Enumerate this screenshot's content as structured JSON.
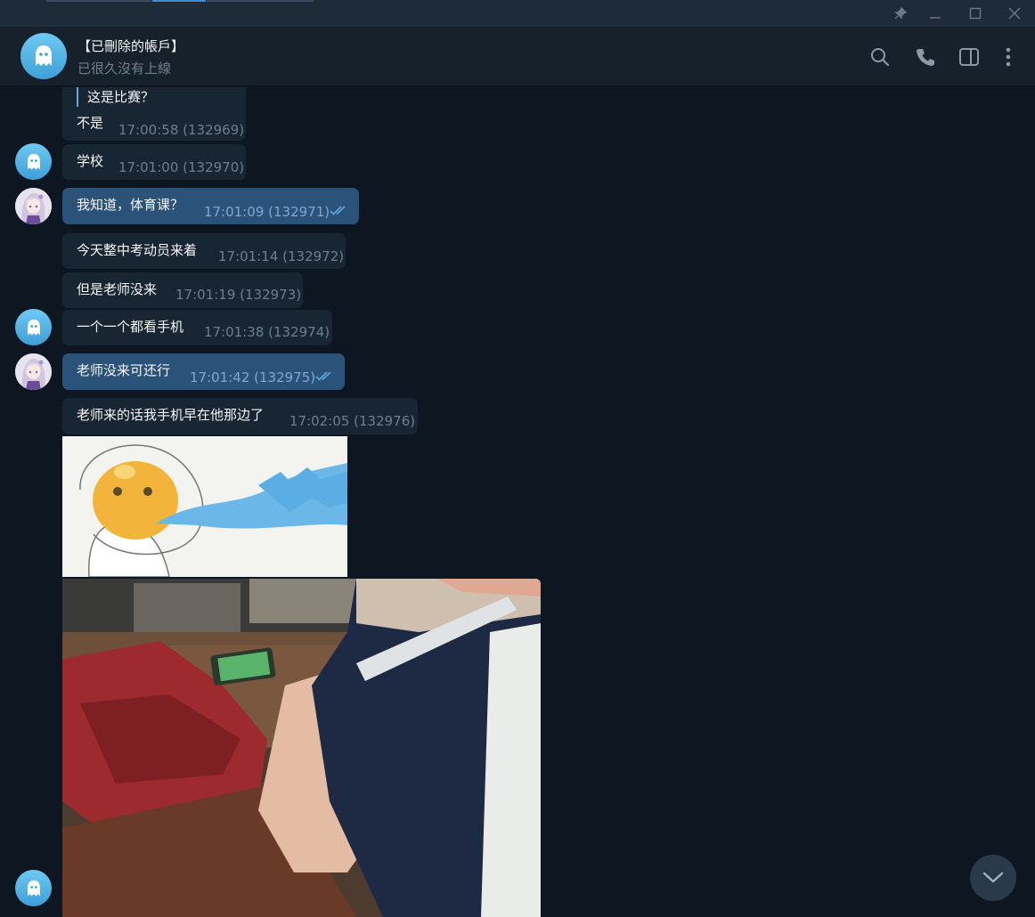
{
  "window": {
    "controls": [
      "pin-icon",
      "minimize-icon",
      "maximize-icon",
      "close-icon"
    ]
  },
  "chat": {
    "name": "【已刪除的帳戶】",
    "status": "已很久沒有上線"
  },
  "header_icons": [
    "search-icon",
    "phone-icon",
    "sidebar-toggle-icon",
    "more-icon"
  ],
  "messages": [
    {
      "reply_text": "这是比赛？",
      "text": "不是",
      "time": "17:00:58 (132969)",
      "outgoing": false
    },
    {
      "text": "学校",
      "time": "17:01:00 (132970)",
      "outgoing": false
    },
    {
      "text": "我知道，体育课？",
      "time": "17:01:09 (132971)",
      "outgoing": true,
      "read": true
    },
    {
      "text": "今天整中考动员来着",
      "time": "17:01:14 (132972)",
      "outgoing": false
    },
    {
      "text": "但是老师没来",
      "time": "17:01:19 (132973)",
      "outgoing": false
    },
    {
      "text": "一个一个都看手机",
      "time": "17:01:38 (132974)",
      "outgoing": false
    },
    {
      "text": "老师没来可还行",
      "time": "17:01:42 (132975)",
      "outgoing": true,
      "read": true
    },
    {
      "text": "老师来的话我手机早在他那边了",
      "time": "17:02:05 (132976)",
      "outgoing": false
    }
  ],
  "colors": {
    "background": "#0e1621",
    "incoming_bubble": "#182533",
    "outgoing_bubble": "#2b5278",
    "accent": "#5fa8e0"
  }
}
